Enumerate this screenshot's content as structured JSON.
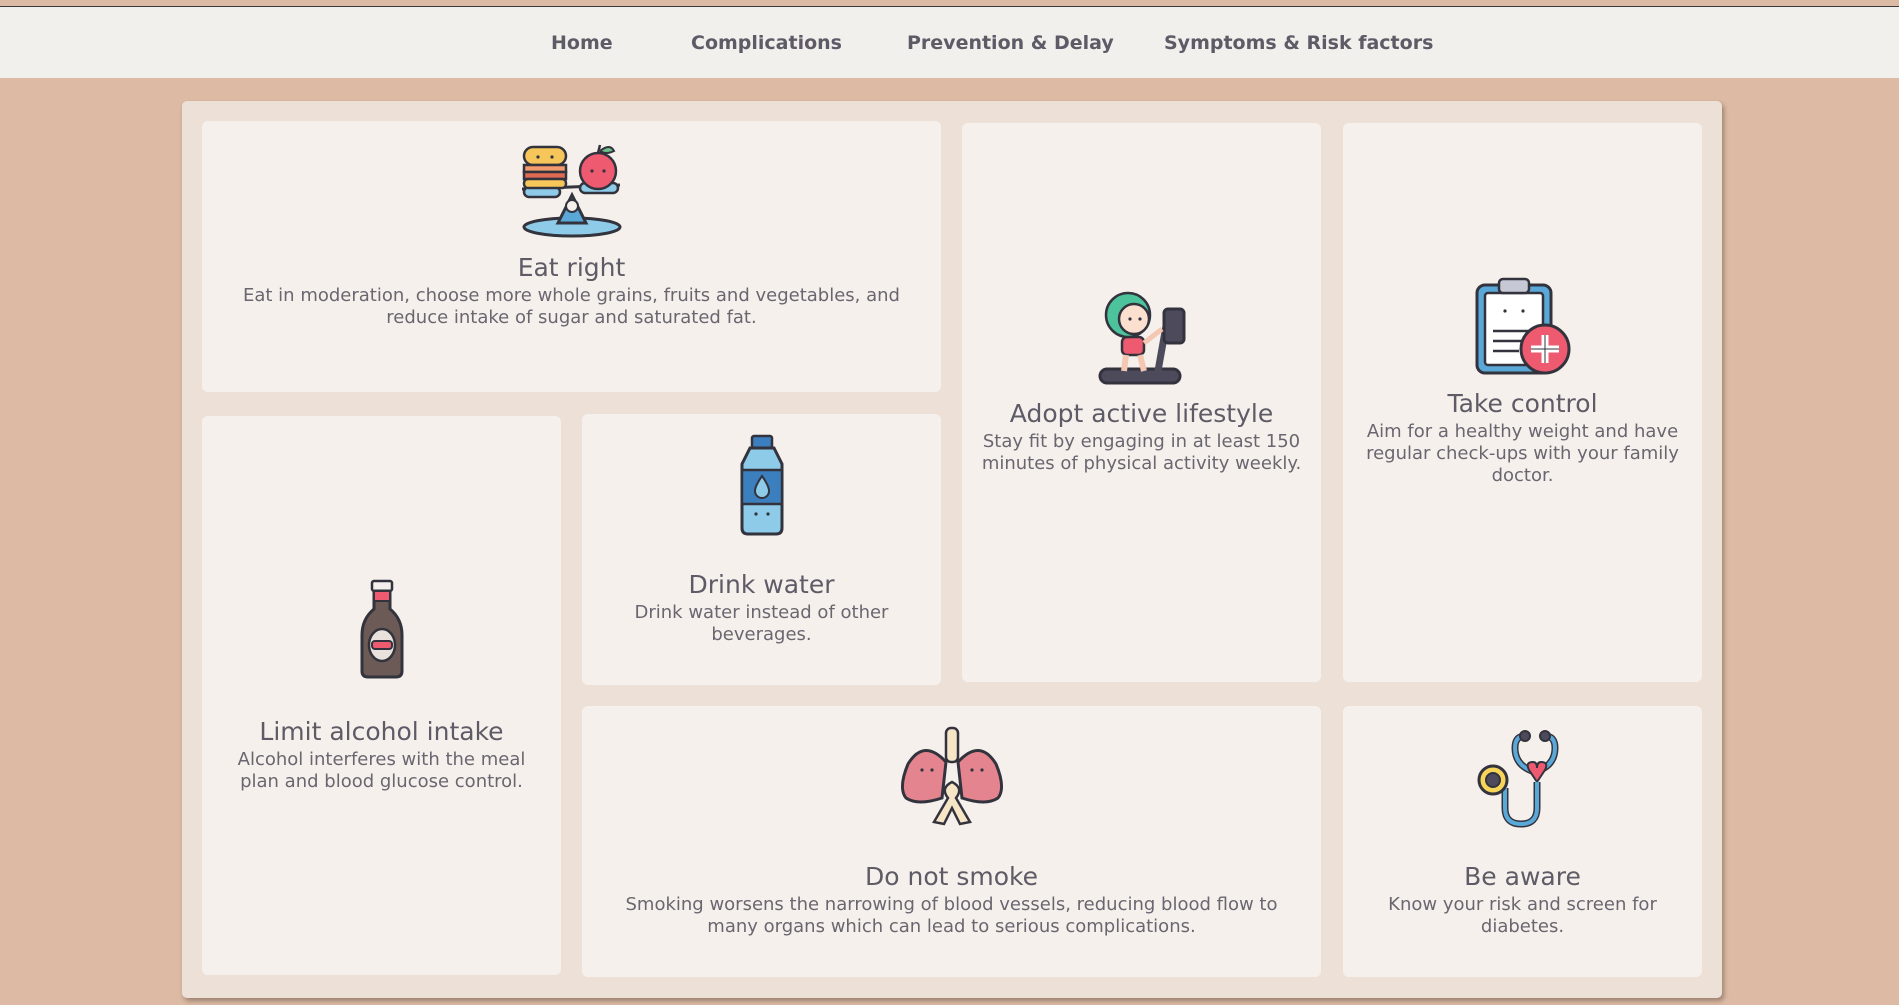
{
  "nav": {
    "items": [
      {
        "label": "Home"
      },
      {
        "label": "Complications"
      },
      {
        "label": "Prevention & Delay"
      },
      {
        "label": "Symptoms & Risk factors"
      }
    ]
  },
  "cards": {
    "eat_right": {
      "title": "Eat right",
      "text": "Eat in moderation, choose more whole grains, fruits and vegetables, and reduce intake of sugar and saturated fat.",
      "icon": "food-scale-icon"
    },
    "active": {
      "title": "Adopt active lifestyle",
      "text": "Stay fit by engaging in at least 150 minutes of physical activity weekly.",
      "icon": "treadmill-icon"
    },
    "control": {
      "title": "Take control",
      "text": "Aim for a healthy weight and have regular check-ups with your family doctor.",
      "icon": "medical-clipboard-icon"
    },
    "alcohol": {
      "title": "Limit alcohol intake",
      "text": "Alcohol interferes with the meal plan and blood glucose control.",
      "icon": "beer-bottle-icon"
    },
    "water": {
      "title": "Drink water",
      "text": "Drink water instead of other beverages.",
      "icon": "water-bottle-icon"
    },
    "smoke": {
      "title": "Do not smoke",
      "text": "Smoking worsens the narrowing of blood vessels, reducing blood flow to many organs which can lead to serious complications.",
      "icon": "lungs-icon"
    },
    "aware": {
      "title": "Be aware",
      "text": "Know your risk and screen for diabetes.",
      "icon": "stethoscope-icon"
    }
  },
  "colors": {
    "page_background": "#dcbaa4",
    "navbar": "#f1f0ec",
    "panel": "#ede0d7",
    "card": "#f6f0ec",
    "text": "#5e5a66"
  }
}
